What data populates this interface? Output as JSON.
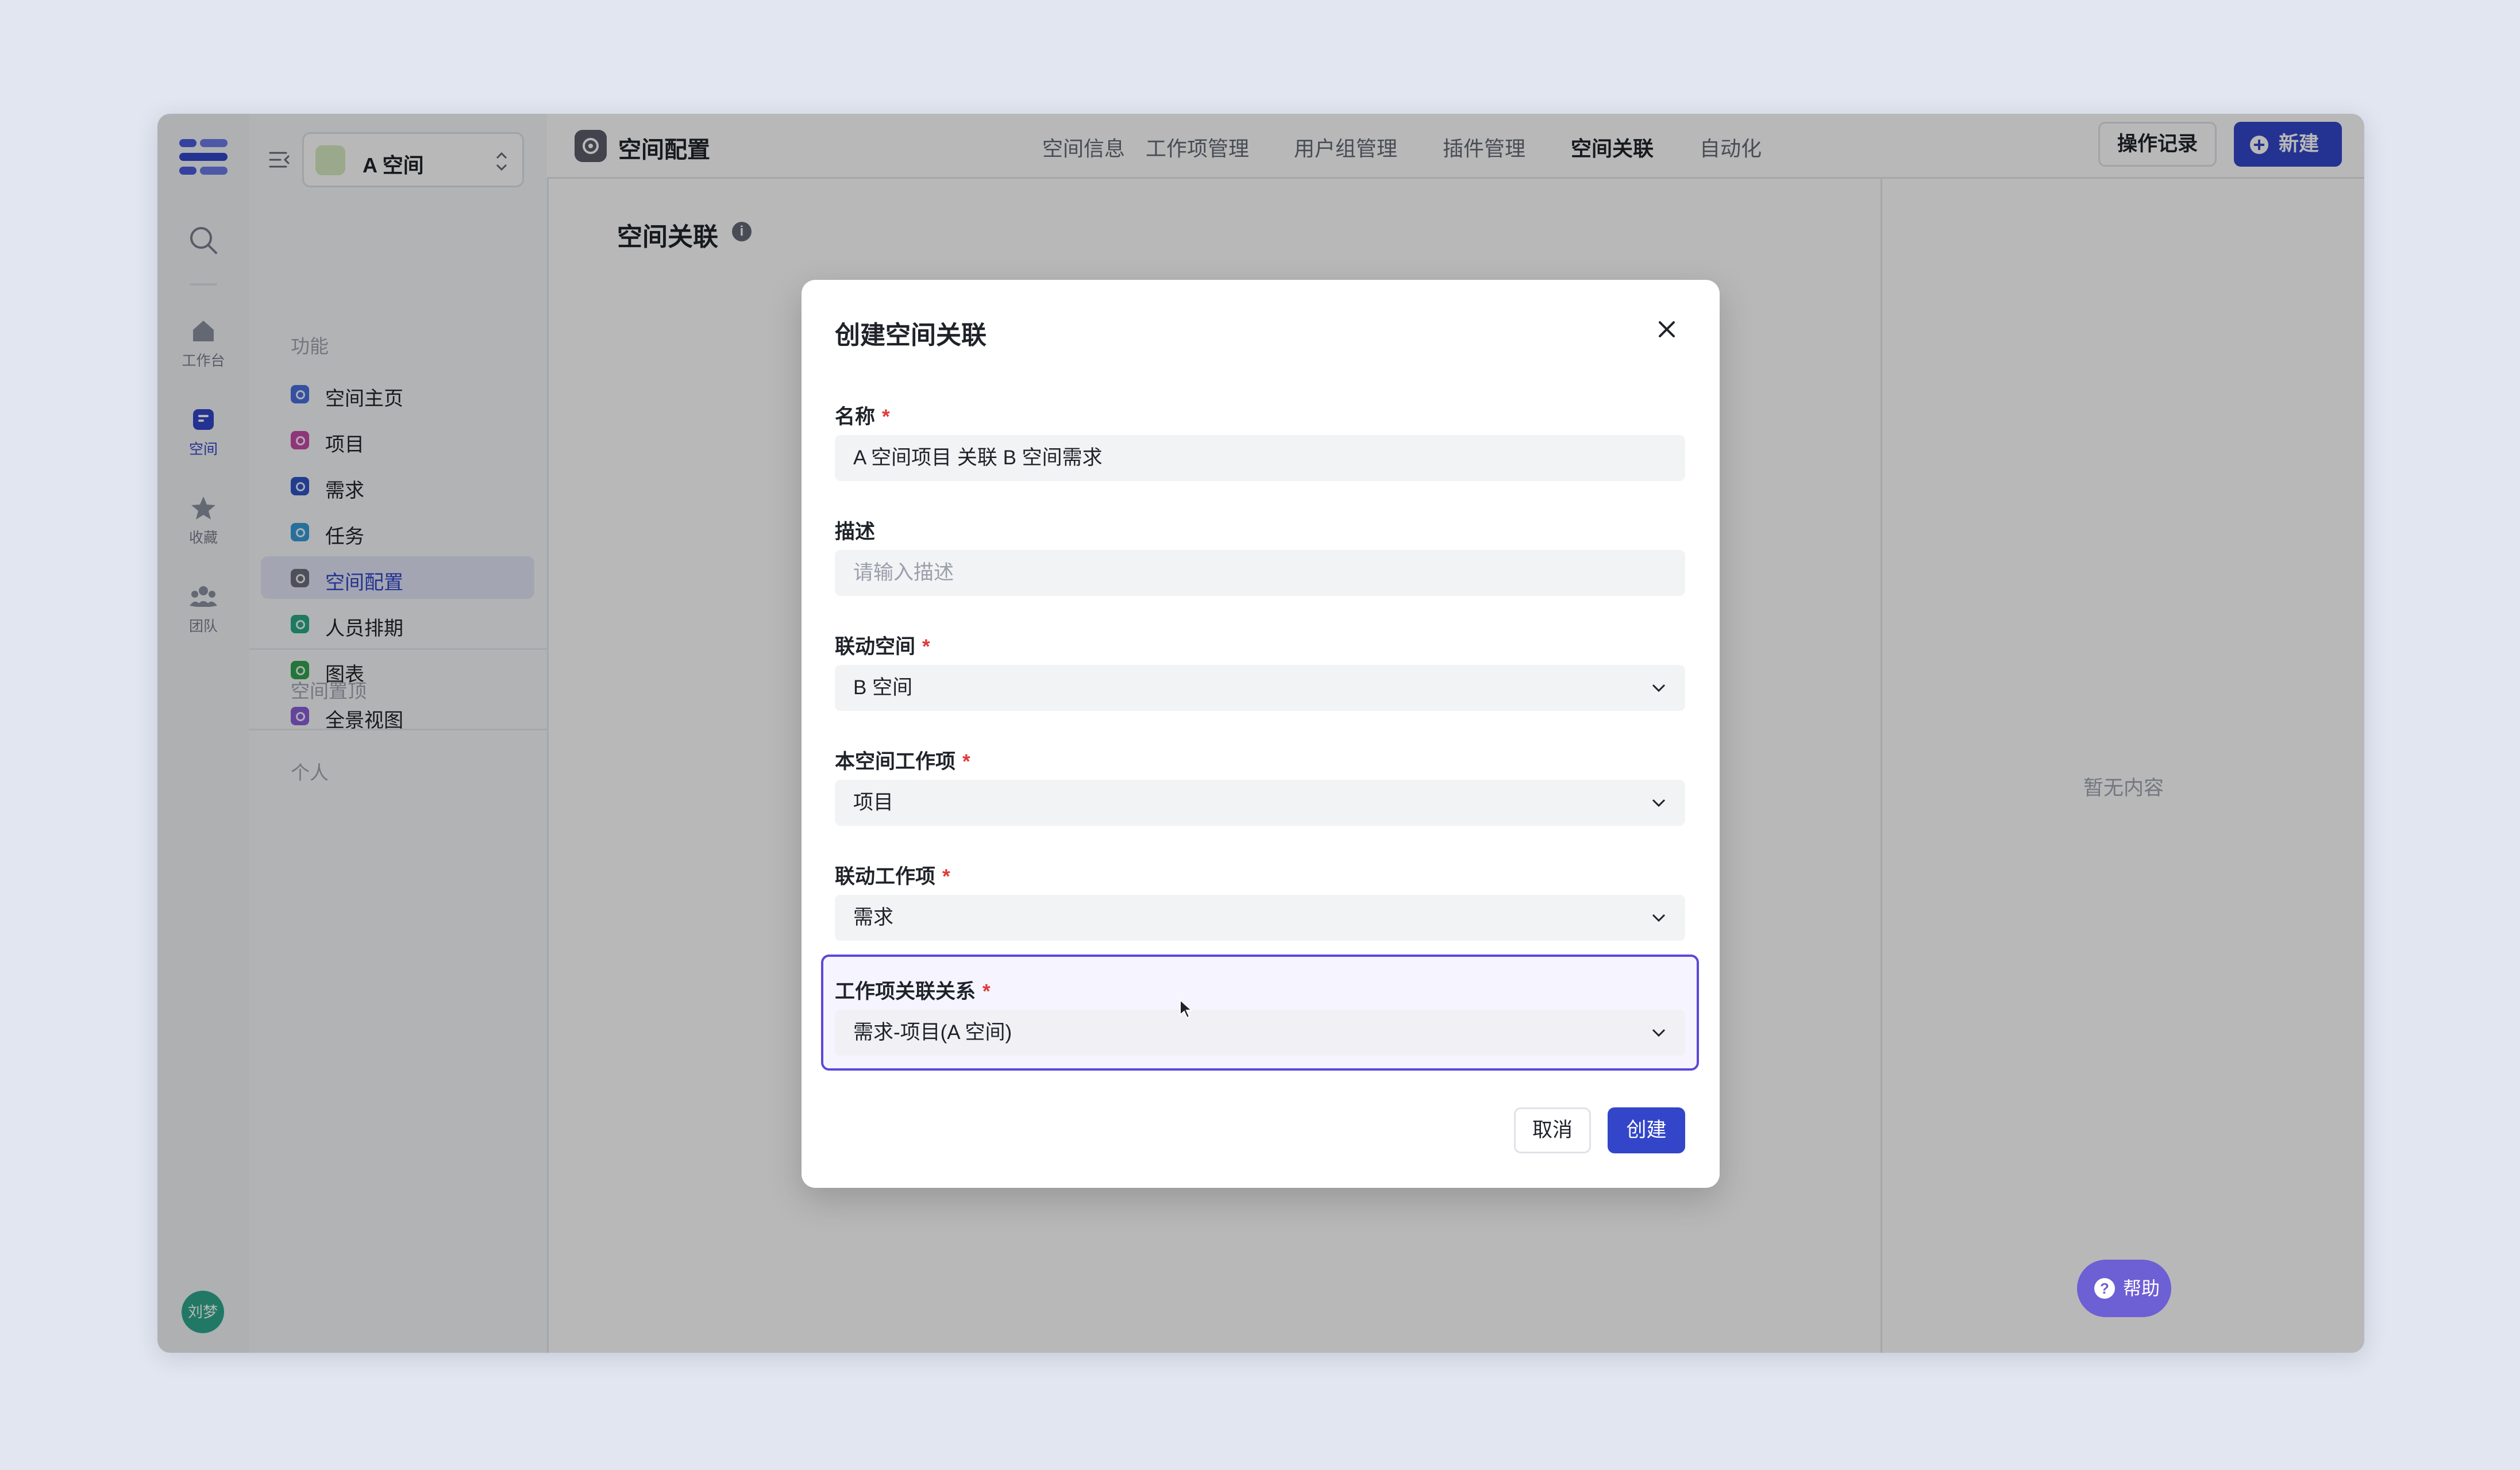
{
  "rail": {
    "items": [
      {
        "label": "工作台"
      },
      {
        "label": "空间"
      },
      {
        "label": "收藏"
      },
      {
        "label": "团队"
      }
    ],
    "avatar": "刘梦"
  },
  "sidebar": {
    "space_name": "A 空间",
    "section_features": "功能",
    "items": [
      {
        "label": "空间主页",
        "color": "#4a6fe0"
      },
      {
        "label": "项目",
        "color": "#c74aa8"
      },
      {
        "label": "需求",
        "color": "#2f55c8"
      },
      {
        "label": "任务",
        "color": "#3a9ad9"
      },
      {
        "label": "空间配置",
        "color": "#6b707c"
      },
      {
        "label": "人员排期",
        "color": "#2aa887"
      },
      {
        "label": "图表",
        "color": "#33a34f"
      },
      {
        "label": "全景视图",
        "color": "#8a5fd9"
      }
    ],
    "section_pinned": "空间置顶",
    "section_personal": "个人"
  },
  "header": {
    "title": "空间配置",
    "tabs": [
      {
        "label": "空间信息"
      },
      {
        "label": "工作项管理"
      },
      {
        "label": "用户组管理"
      },
      {
        "label": "插件管理"
      },
      {
        "label": "空间关联"
      },
      {
        "label": "自动化"
      }
    ],
    "log_button": "操作记录",
    "new_button": "新建"
  },
  "content": {
    "title": "空间关联",
    "empty_text": "暂无内容",
    "help": "帮助"
  },
  "modal": {
    "title": "创建空间关联",
    "fields": {
      "name": {
        "label": "名称",
        "value": "A 空间项目 关联 B 空间需求"
      },
      "desc": {
        "label": "描述",
        "placeholder": "请输入描述"
      },
      "linked_space": {
        "label": "联动空间",
        "value": "B 空间"
      },
      "this_item": {
        "label": "本空间工作项",
        "value": "项目"
      },
      "linked_item": {
        "label": "联动工作项",
        "value": "需求"
      },
      "relation": {
        "label": "工作项关联关系",
        "value": "需求-项目(A 空间)"
      }
    },
    "required_mark": "*",
    "cancel": "取消",
    "create": "创建"
  },
  "colors": {
    "accent": "#3346c9",
    "focus": "#5b48d9",
    "required": "#e03a3a"
  }
}
